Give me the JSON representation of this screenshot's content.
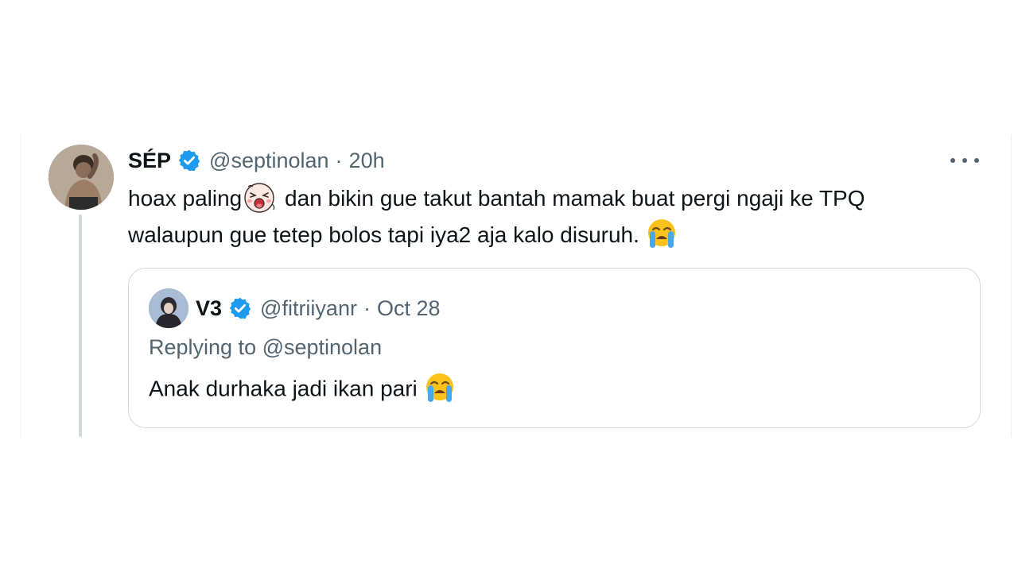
{
  "tweet": {
    "author": {
      "display_name": "SÉP",
      "handle": "@septinolan",
      "separator": "·",
      "time": "20h",
      "verified": true,
      "avatar_icon": "user-avatar-photo"
    },
    "text_line1_start": "hoax paling",
    "text_line1_end": " dan bikin gue takut bantah mamak buat pergi ngaji ke TPQ",
    "text_line2": "walaupun gue tetep bolos tapi iya2 aja kalo disuruh. ",
    "inline_emojis": [
      "laughing-crying-sticker-emoji",
      "loudly-crying-face-emoji"
    ],
    "more_icon": "more-horizontal-icon"
  },
  "quoted_tweet": {
    "author": {
      "display_name": "V3",
      "handle": "@fitriiyanr",
      "separator": "·",
      "date": "Oct 28",
      "verified": true,
      "avatar_icon": "user-avatar-photo"
    },
    "replying_to": "Replying to @septinolan",
    "text": "Anak durhaka jadi ikan pari ",
    "inline_emojis": [
      "loudly-crying-face-emoji"
    ]
  },
  "colors": {
    "text_primary": "#0f1419",
    "text_secondary": "#536471",
    "border": "#cfd9de",
    "verified_blue": "#1d9bf0",
    "background": "#ffffff"
  }
}
